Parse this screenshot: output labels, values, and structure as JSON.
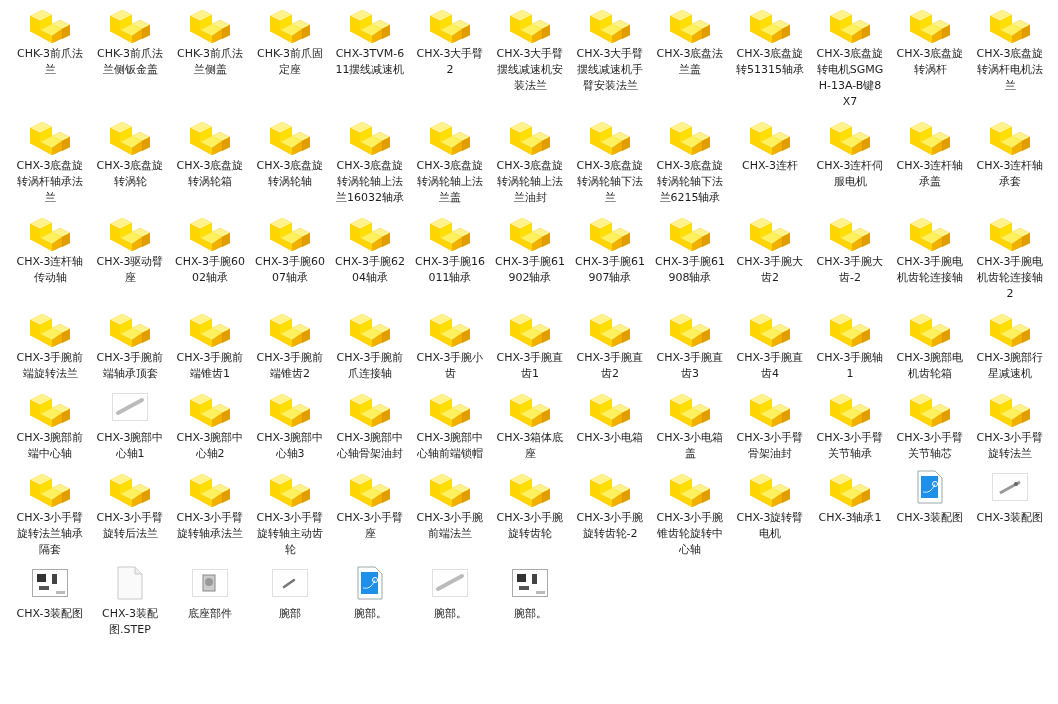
{
  "files": [
    {
      "name": "CHK-3前爪法兰",
      "kind": "part"
    },
    {
      "name": "CHK-3前爪法兰侧钣金盖",
      "kind": "part"
    },
    {
      "name": "CHK-3前爪法兰侧盖",
      "kind": "part"
    },
    {
      "name": "CHK-3前爪固定座",
      "kind": "part"
    },
    {
      "name": "CHX-3TVM-611摆线减速机",
      "kind": "part"
    },
    {
      "name": "CHX-3大手臂2",
      "kind": "part"
    },
    {
      "name": "CHX-3大手臂摆线减速机安装法兰",
      "kind": "part"
    },
    {
      "name": "CHX-3大手臂摆线减速机手臂安装法兰",
      "kind": "part"
    },
    {
      "name": "CHX-3底盘法兰盖",
      "kind": "part"
    },
    {
      "name": "CHX-3底盘旋转51315轴承",
      "kind": "part"
    },
    {
      "name": "CHX-3底盘旋转电机SGMGH-13A-B键8X7",
      "kind": "part"
    },
    {
      "name": "CHX-3底盘旋转涡杆",
      "kind": "part"
    },
    {
      "name": "CHX-3底盘旋转涡杆电机法兰",
      "kind": "part"
    },
    {
      "name": "CHX-3底盘旋转涡杆轴承法兰",
      "kind": "part"
    },
    {
      "name": "CHX-3底盘旋转涡轮",
      "kind": "part"
    },
    {
      "name": "CHX-3底盘旋转涡轮箱",
      "kind": "part"
    },
    {
      "name": "CHX-3底盘旋转涡轮轴",
      "kind": "part"
    },
    {
      "name": "CHX-3底盘旋转涡轮轴上法兰16032轴承",
      "kind": "part"
    },
    {
      "name": "CHX-3底盘旋转涡轮轴上法兰盖",
      "kind": "part"
    },
    {
      "name": "CHX-3底盘旋转涡轮轴上法兰油封",
      "kind": "part"
    },
    {
      "name": "CHX-3底盘旋转涡轮轴下法兰",
      "kind": "part"
    },
    {
      "name": "CHX-3底盘旋转涡轮轴下法兰6215轴承",
      "kind": "part"
    },
    {
      "name": "CHX-3连杆",
      "kind": "part"
    },
    {
      "name": "CHX-3连杆伺服电机",
      "kind": "part"
    },
    {
      "name": "CHX-3连杆轴承盖",
      "kind": "part"
    },
    {
      "name": "CHX-3连杆轴承套",
      "kind": "part"
    },
    {
      "name": "CHX-3连杆轴传动轴",
      "kind": "part"
    },
    {
      "name": "CHX-3驱动臂座",
      "kind": "part"
    },
    {
      "name": "CHX-3手腕6002轴承",
      "kind": "part"
    },
    {
      "name": "CHX-3手腕6007轴承",
      "kind": "part"
    },
    {
      "name": "CHX-3手腕6204轴承",
      "kind": "part"
    },
    {
      "name": "CHX-3手腕16011轴承",
      "kind": "part"
    },
    {
      "name": "CHX-3手腕61902轴承",
      "kind": "part"
    },
    {
      "name": "CHX-3手腕61907轴承",
      "kind": "part"
    },
    {
      "name": "CHX-3手腕61908轴承",
      "kind": "part"
    },
    {
      "name": "CHX-3手腕大齿2",
      "kind": "part"
    },
    {
      "name": "CHX-3手腕大齿-2",
      "kind": "part"
    },
    {
      "name": "CHX-3手腕电机齿轮连接轴",
      "kind": "part"
    },
    {
      "name": "CHX-3手腕电机齿轮连接轴2",
      "kind": "part"
    },
    {
      "name": "CHX-3手腕前端旋转法兰",
      "kind": "part"
    },
    {
      "name": "CHX-3手腕前端轴承顶套",
      "kind": "part"
    },
    {
      "name": "CHX-3手腕前端锥齿1",
      "kind": "part"
    },
    {
      "name": "CHX-3手腕前端锥齿2",
      "kind": "part"
    },
    {
      "name": "CHX-3手腕前爪连接轴",
      "kind": "part"
    },
    {
      "name": "CHX-3手腕小齿",
      "kind": "part"
    },
    {
      "name": "CHX-3手腕直齿1",
      "kind": "part"
    },
    {
      "name": "CHX-3手腕直齿2",
      "kind": "part"
    },
    {
      "name": "CHX-3手腕直齿3",
      "kind": "part"
    },
    {
      "name": "CHX-3手腕直齿4",
      "kind": "part"
    },
    {
      "name": "CHX-3手腕轴1",
      "kind": "part"
    },
    {
      "name": "CHX-3腕部电机齿轮箱",
      "kind": "part"
    },
    {
      "name": "CHX-3腕部行星减速机",
      "kind": "part"
    },
    {
      "name": "CHX-3腕部前端中心轴",
      "kind": "part"
    },
    {
      "name": "CHX-3腕部中心轴1",
      "kind": "shaft"
    },
    {
      "name": "CHX-3腕部中心轴2",
      "kind": "part"
    },
    {
      "name": "CHX-3腕部中心轴3",
      "kind": "part"
    },
    {
      "name": "CHX-3腕部中心轴骨架油封",
      "kind": "part"
    },
    {
      "name": "CHX-3腕部中心轴前端锁帽",
      "kind": "part"
    },
    {
      "name": "CHX-3箱体底座",
      "kind": "part"
    },
    {
      "name": "CHX-3小电箱",
      "kind": "part"
    },
    {
      "name": "CHX-3小电箱盖",
      "kind": "part"
    },
    {
      "name": "CHX-3小手臂骨架油封",
      "kind": "part"
    },
    {
      "name": "CHX-3小手臂关节轴承",
      "kind": "part"
    },
    {
      "name": "CHX-3小手臂关节轴芯",
      "kind": "part"
    },
    {
      "name": "CHX-3小手臂旋转法兰",
      "kind": "part"
    },
    {
      "name": "CHX-3小手臂旋转法兰轴承隔套",
      "kind": "part"
    },
    {
      "name": "CHX-3小手臂旋转后法兰",
      "kind": "part"
    },
    {
      "name": "CHX-3小手臂旋转轴承法兰",
      "kind": "part"
    },
    {
      "name": "CHX-3小手臂旋转轴主动齿轮",
      "kind": "part"
    },
    {
      "name": "CHX-3小手臂座",
      "kind": "part"
    },
    {
      "name": "CHX-3小手腕前端法兰",
      "kind": "part"
    },
    {
      "name": "CHX-3小手腕旋转齿轮",
      "kind": "part"
    },
    {
      "name": "CHX-3小手腕旋转齿轮-2",
      "kind": "part"
    },
    {
      "name": "CHX-3小手腕锥齿轮旋转中心轴",
      "kind": "part"
    },
    {
      "name": "CHX-3旋转臂电机",
      "kind": "part"
    },
    {
      "name": "CHX-3轴承1",
      "kind": "part"
    },
    {
      "name": "CHX-3装配图",
      "kind": "drawing"
    },
    {
      "name": "CHX-3装配图",
      "kind": "assembly"
    },
    {
      "name": "CHX-3装配图",
      "kind": "sheet"
    },
    {
      "name": "CHX-3装配图.STEP",
      "kind": "blank"
    },
    {
      "name": "底座部件",
      "kind": "base"
    },
    {
      "name": "腕部",
      "kind": "small"
    },
    {
      "name": "腕部。",
      "kind": "drawing"
    },
    {
      "name": "腕部。",
      "kind": "shaft"
    },
    {
      "name": "腕部。",
      "kind": "sheet"
    }
  ]
}
